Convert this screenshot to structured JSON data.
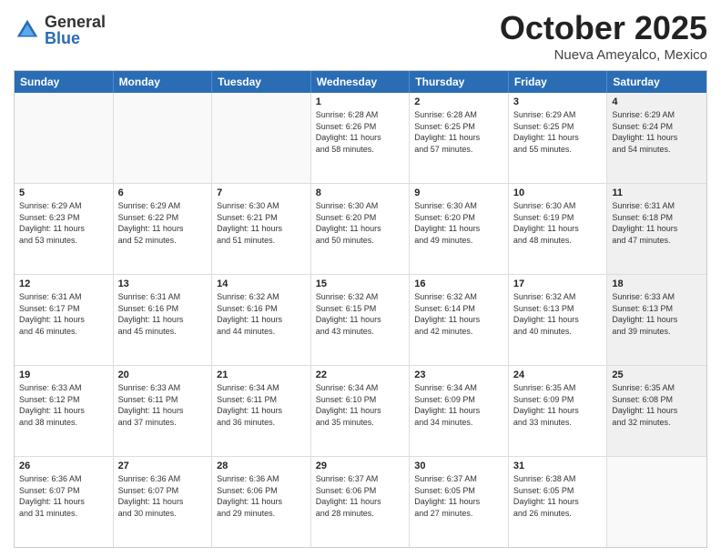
{
  "logo": {
    "general": "General",
    "blue": "Blue"
  },
  "title": "October 2025",
  "location": "Nueva Ameyalco, Mexico",
  "header_days": [
    "Sunday",
    "Monday",
    "Tuesday",
    "Wednesday",
    "Thursday",
    "Friday",
    "Saturday"
  ],
  "rows": [
    [
      {
        "day": "",
        "lines": [],
        "empty": true
      },
      {
        "day": "",
        "lines": [],
        "empty": true
      },
      {
        "day": "",
        "lines": [],
        "empty": true
      },
      {
        "day": "1",
        "lines": [
          "Sunrise: 6:28 AM",
          "Sunset: 6:26 PM",
          "Daylight: 11 hours",
          "and 58 minutes."
        ]
      },
      {
        "day": "2",
        "lines": [
          "Sunrise: 6:28 AM",
          "Sunset: 6:25 PM",
          "Daylight: 11 hours",
          "and 57 minutes."
        ]
      },
      {
        "day": "3",
        "lines": [
          "Sunrise: 6:29 AM",
          "Sunset: 6:25 PM",
          "Daylight: 11 hours",
          "and 55 minutes."
        ]
      },
      {
        "day": "4",
        "lines": [
          "Sunrise: 6:29 AM",
          "Sunset: 6:24 PM",
          "Daylight: 11 hours",
          "and 54 minutes."
        ],
        "shaded": true
      }
    ],
    [
      {
        "day": "5",
        "lines": [
          "Sunrise: 6:29 AM",
          "Sunset: 6:23 PM",
          "Daylight: 11 hours",
          "and 53 minutes."
        ]
      },
      {
        "day": "6",
        "lines": [
          "Sunrise: 6:29 AM",
          "Sunset: 6:22 PM",
          "Daylight: 11 hours",
          "and 52 minutes."
        ]
      },
      {
        "day": "7",
        "lines": [
          "Sunrise: 6:30 AM",
          "Sunset: 6:21 PM",
          "Daylight: 11 hours",
          "and 51 minutes."
        ]
      },
      {
        "day": "8",
        "lines": [
          "Sunrise: 6:30 AM",
          "Sunset: 6:20 PM",
          "Daylight: 11 hours",
          "and 50 minutes."
        ]
      },
      {
        "day": "9",
        "lines": [
          "Sunrise: 6:30 AM",
          "Sunset: 6:20 PM",
          "Daylight: 11 hours",
          "and 49 minutes."
        ]
      },
      {
        "day": "10",
        "lines": [
          "Sunrise: 6:30 AM",
          "Sunset: 6:19 PM",
          "Daylight: 11 hours",
          "and 48 minutes."
        ]
      },
      {
        "day": "11",
        "lines": [
          "Sunrise: 6:31 AM",
          "Sunset: 6:18 PM",
          "Daylight: 11 hours",
          "and 47 minutes."
        ],
        "shaded": true
      }
    ],
    [
      {
        "day": "12",
        "lines": [
          "Sunrise: 6:31 AM",
          "Sunset: 6:17 PM",
          "Daylight: 11 hours",
          "and 46 minutes."
        ]
      },
      {
        "day": "13",
        "lines": [
          "Sunrise: 6:31 AM",
          "Sunset: 6:16 PM",
          "Daylight: 11 hours",
          "and 45 minutes."
        ]
      },
      {
        "day": "14",
        "lines": [
          "Sunrise: 6:32 AM",
          "Sunset: 6:16 PM",
          "Daylight: 11 hours",
          "and 44 minutes."
        ]
      },
      {
        "day": "15",
        "lines": [
          "Sunrise: 6:32 AM",
          "Sunset: 6:15 PM",
          "Daylight: 11 hours",
          "and 43 minutes."
        ]
      },
      {
        "day": "16",
        "lines": [
          "Sunrise: 6:32 AM",
          "Sunset: 6:14 PM",
          "Daylight: 11 hours",
          "and 42 minutes."
        ]
      },
      {
        "day": "17",
        "lines": [
          "Sunrise: 6:32 AM",
          "Sunset: 6:13 PM",
          "Daylight: 11 hours",
          "and 40 minutes."
        ]
      },
      {
        "day": "18",
        "lines": [
          "Sunrise: 6:33 AM",
          "Sunset: 6:13 PM",
          "Daylight: 11 hours",
          "and 39 minutes."
        ],
        "shaded": true
      }
    ],
    [
      {
        "day": "19",
        "lines": [
          "Sunrise: 6:33 AM",
          "Sunset: 6:12 PM",
          "Daylight: 11 hours",
          "and 38 minutes."
        ]
      },
      {
        "day": "20",
        "lines": [
          "Sunrise: 6:33 AM",
          "Sunset: 6:11 PM",
          "Daylight: 11 hours",
          "and 37 minutes."
        ]
      },
      {
        "day": "21",
        "lines": [
          "Sunrise: 6:34 AM",
          "Sunset: 6:11 PM",
          "Daylight: 11 hours",
          "and 36 minutes."
        ]
      },
      {
        "day": "22",
        "lines": [
          "Sunrise: 6:34 AM",
          "Sunset: 6:10 PM",
          "Daylight: 11 hours",
          "and 35 minutes."
        ]
      },
      {
        "day": "23",
        "lines": [
          "Sunrise: 6:34 AM",
          "Sunset: 6:09 PM",
          "Daylight: 11 hours",
          "and 34 minutes."
        ]
      },
      {
        "day": "24",
        "lines": [
          "Sunrise: 6:35 AM",
          "Sunset: 6:09 PM",
          "Daylight: 11 hours",
          "and 33 minutes."
        ]
      },
      {
        "day": "25",
        "lines": [
          "Sunrise: 6:35 AM",
          "Sunset: 6:08 PM",
          "Daylight: 11 hours",
          "and 32 minutes."
        ],
        "shaded": true
      }
    ],
    [
      {
        "day": "26",
        "lines": [
          "Sunrise: 6:36 AM",
          "Sunset: 6:07 PM",
          "Daylight: 11 hours",
          "and 31 minutes."
        ]
      },
      {
        "day": "27",
        "lines": [
          "Sunrise: 6:36 AM",
          "Sunset: 6:07 PM",
          "Daylight: 11 hours",
          "and 30 minutes."
        ]
      },
      {
        "day": "28",
        "lines": [
          "Sunrise: 6:36 AM",
          "Sunset: 6:06 PM",
          "Daylight: 11 hours",
          "and 29 minutes."
        ]
      },
      {
        "day": "29",
        "lines": [
          "Sunrise: 6:37 AM",
          "Sunset: 6:06 PM",
          "Daylight: 11 hours",
          "and 28 minutes."
        ]
      },
      {
        "day": "30",
        "lines": [
          "Sunrise: 6:37 AM",
          "Sunset: 6:05 PM",
          "Daylight: 11 hours",
          "and 27 minutes."
        ]
      },
      {
        "day": "31",
        "lines": [
          "Sunrise: 6:38 AM",
          "Sunset: 6:05 PM",
          "Daylight: 11 hours",
          "and 26 minutes."
        ]
      },
      {
        "day": "",
        "lines": [],
        "empty": true
      }
    ]
  ]
}
